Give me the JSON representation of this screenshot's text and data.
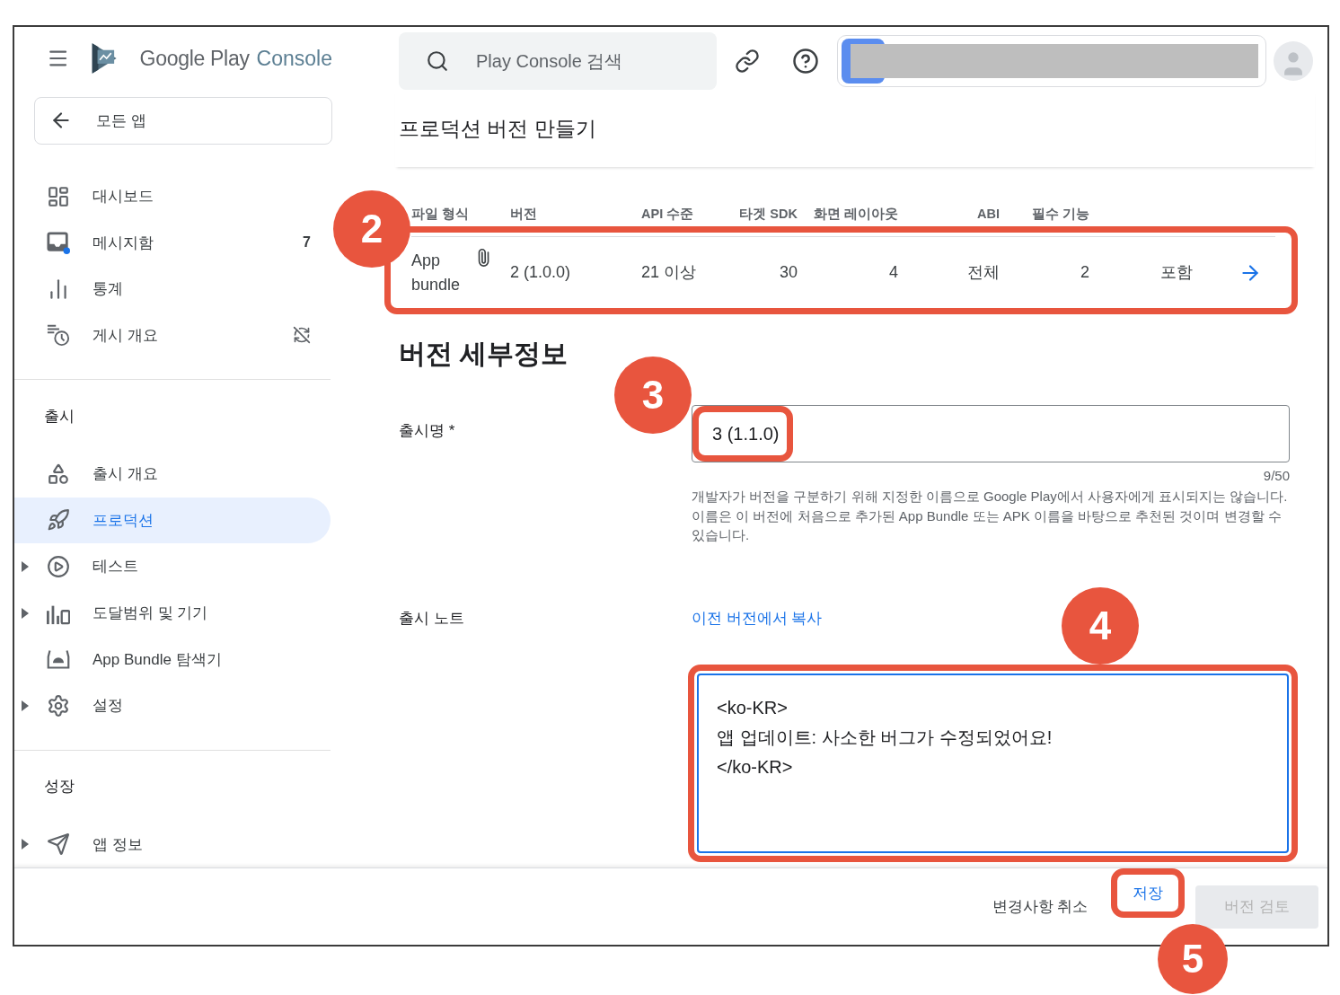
{
  "logo": {
    "brand": "Google Play",
    "product": "Console"
  },
  "back_button": {
    "label": "모든 앱"
  },
  "sidebar": {
    "top_items": [
      {
        "label": "대시보드",
        "selected": false
      },
      {
        "label": "메시지함",
        "selected": false,
        "count": "7"
      },
      {
        "label": "통계",
        "selected": false
      },
      {
        "label": "게시 개요",
        "selected": false
      }
    ],
    "sections": [
      {
        "title": "출시",
        "items": [
          {
            "label": "출시 개요",
            "selected": false,
            "expandable": false
          },
          {
            "label": "프로덕션",
            "selected": true,
            "expandable": false
          },
          {
            "label": "테스트",
            "selected": false,
            "expandable": true
          },
          {
            "label": "도달범위 및 기기",
            "selected": false,
            "expandable": true
          },
          {
            "label": "App Bundle 탐색기",
            "selected": false,
            "expandable": false
          },
          {
            "label": "설정",
            "selected": false,
            "expandable": true
          }
        ]
      },
      {
        "title": "성장",
        "items": [
          {
            "label": "앱 정보",
            "selected": false,
            "expandable": true
          }
        ]
      }
    ]
  },
  "search": {
    "placeholder": "Play Console 검색"
  },
  "page_title": "프로덕션 버전 만들기",
  "table": {
    "columns": [
      "파일 형식",
      "버전",
      "API 수준",
      "타겟 SDK",
      "화면 레이아웃",
      "ABI",
      "필수 기능"
    ],
    "rows": [
      {
        "cells": [
          "App bundle",
          "2 (1.0.0)",
          "21 이상",
          "30",
          "4",
          "전체",
          "2",
          "포함"
        ]
      }
    ]
  },
  "details": {
    "title": "버전 세부정보",
    "release_name": {
      "label": "출시명",
      "required_mark": "*",
      "value": "3 (1.1.0)",
      "counter": "9/50",
      "help": "개발자가 버전을 구분하기 위해 지정한 이름으로 Google Play에서 사용자에게 표시되지는 않습니다. 이름은 이 버전에 처음으로 추가된 App Bundle 또는 APK 이름을 바탕으로 추천된 것이며 변경할 수 있습니다."
    },
    "release_notes": {
      "label": "출시 노트",
      "copy_link": "이전 버전에서 복사",
      "lines": [
        "<ko-KR>",
        "앱 업데이트: 사소한 버그가 수정되었어요!",
        "</ko-KR>"
      ]
    }
  },
  "footer": {
    "buttons": [
      {
        "label": "변경사항 취소",
        "kind": "text",
        "disabled": false
      },
      {
        "label": "저장",
        "kind": "primary-text",
        "disabled": false
      },
      {
        "label": "버전 검토",
        "kind": "filled",
        "disabled": true
      }
    ]
  },
  "annotations": [
    {
      "number": "2"
    },
    {
      "number": "3"
    },
    {
      "number": "4"
    },
    {
      "number": "5"
    }
  ]
}
